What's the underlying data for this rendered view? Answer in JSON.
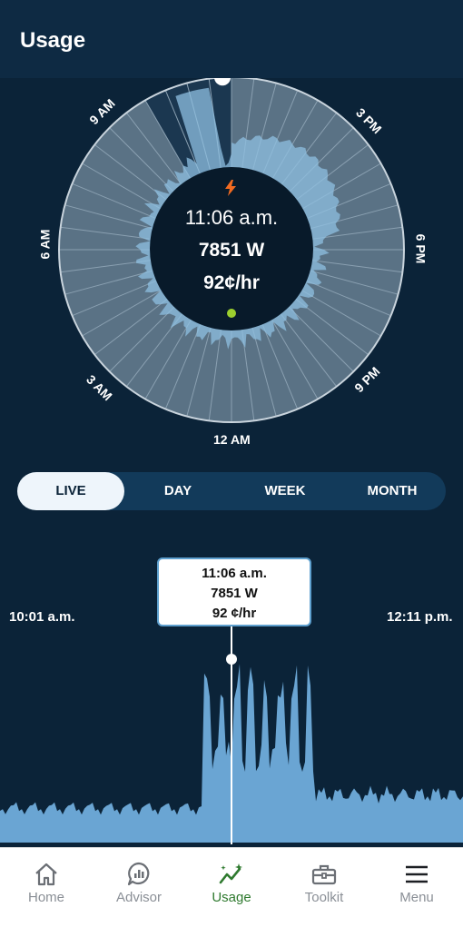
{
  "header": {
    "title": "Usage"
  },
  "dial": {
    "current_time": "11:06 a.m.",
    "current_watts": "7851 W",
    "current_rate": "92¢/hr",
    "hour_labels": [
      "9 AM",
      "3 PM",
      "6 AM",
      "6 PM",
      "3 AM",
      "9 PM",
      "12 AM"
    ],
    "accent_color": "#f26b21",
    "status_dot_color": "#9ccf2e"
  },
  "tabs": [
    {
      "label": "LIVE",
      "active": true
    },
    {
      "label": "DAY",
      "active": false
    },
    {
      "label": "WEEK",
      "active": false
    },
    {
      "label": "MONTH",
      "active": false
    }
  ],
  "live_chart": {
    "start_label": "10:01 a.m.",
    "end_label": "12:11 p.m.",
    "tooltip": {
      "time": "11:06 a.m.",
      "watts": "7851 W",
      "rate": "92 ¢/hr"
    },
    "fill_color": "#6aa5d3"
  },
  "nav": {
    "items": [
      {
        "label": "Home",
        "icon": "home-icon",
        "active": false
      },
      {
        "label": "Advisor",
        "icon": "advisor-chat-icon",
        "active": false
      },
      {
        "label": "Usage",
        "icon": "usage-sparkline-icon",
        "active": true
      },
      {
        "label": "Toolkit",
        "icon": "toolbox-icon",
        "active": false
      },
      {
        "label": "Menu",
        "icon": "hamburger-menu-icon",
        "active": false
      }
    ]
  }
}
